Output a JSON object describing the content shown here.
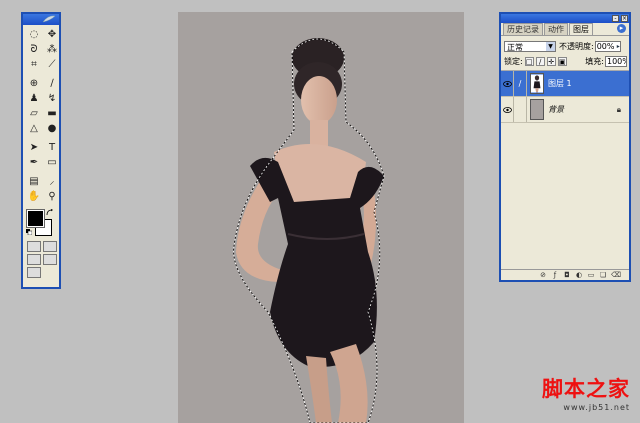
{
  "tools_palette": {
    "tools": [
      {
        "name": "marquee-tool-icon",
        "glyph": "◌"
      },
      {
        "name": "move-tool-icon",
        "glyph": "✥"
      },
      {
        "name": "lasso-tool-icon",
        "glyph": "ᘐ"
      },
      {
        "name": "magic-wand-icon",
        "glyph": "⁂"
      },
      {
        "name": "crop-tool-icon",
        "glyph": "⌗"
      },
      {
        "name": "slice-tool-icon",
        "glyph": "⟋"
      },
      {
        "name": "healing-brush-icon",
        "glyph": "⊕"
      },
      {
        "name": "brush-tool-icon",
        "glyph": "∕"
      },
      {
        "name": "clone-stamp-icon",
        "glyph": "♟"
      },
      {
        "name": "history-brush-icon",
        "glyph": "↯"
      },
      {
        "name": "eraser-tool-icon",
        "glyph": "▱"
      },
      {
        "name": "gradient-tool-icon",
        "glyph": "▬"
      },
      {
        "name": "blur-tool-icon",
        "glyph": "△"
      },
      {
        "name": "dodge-tool-icon",
        "glyph": "●"
      },
      {
        "name": "path-select-icon",
        "glyph": "➤"
      },
      {
        "name": "type-tool-icon",
        "glyph": "T"
      },
      {
        "name": "pen-tool-icon",
        "glyph": "✒"
      },
      {
        "name": "rectangle-tool-icon",
        "glyph": "▭"
      },
      {
        "name": "notes-tool-icon",
        "glyph": "▤"
      },
      {
        "name": "eyedropper-icon",
        "glyph": "⸝"
      },
      {
        "name": "hand-tool-icon",
        "glyph": "✋"
      },
      {
        "name": "zoom-tool-icon",
        "glyph": "⚲"
      }
    ]
  },
  "layers_panel": {
    "tabs": [
      "历史记录",
      "动作",
      "图层"
    ],
    "blend_mode": "正常",
    "opacity_label": "不透明度:",
    "opacity_value": "00%",
    "lock_label": "锁定:",
    "fill_label": "填充:",
    "fill_value": "100%",
    "layers": [
      {
        "name": "图层 1",
        "selected": true
      },
      {
        "name": "背景",
        "selected": false
      }
    ]
  },
  "watermark": {
    "text": "脚本之家",
    "url": "www.jb51.net"
  },
  "colors": {
    "selection": "#3b6fd1",
    "canvas_bg": "#a6a19f",
    "title_bar": "#1d4fb3"
  }
}
